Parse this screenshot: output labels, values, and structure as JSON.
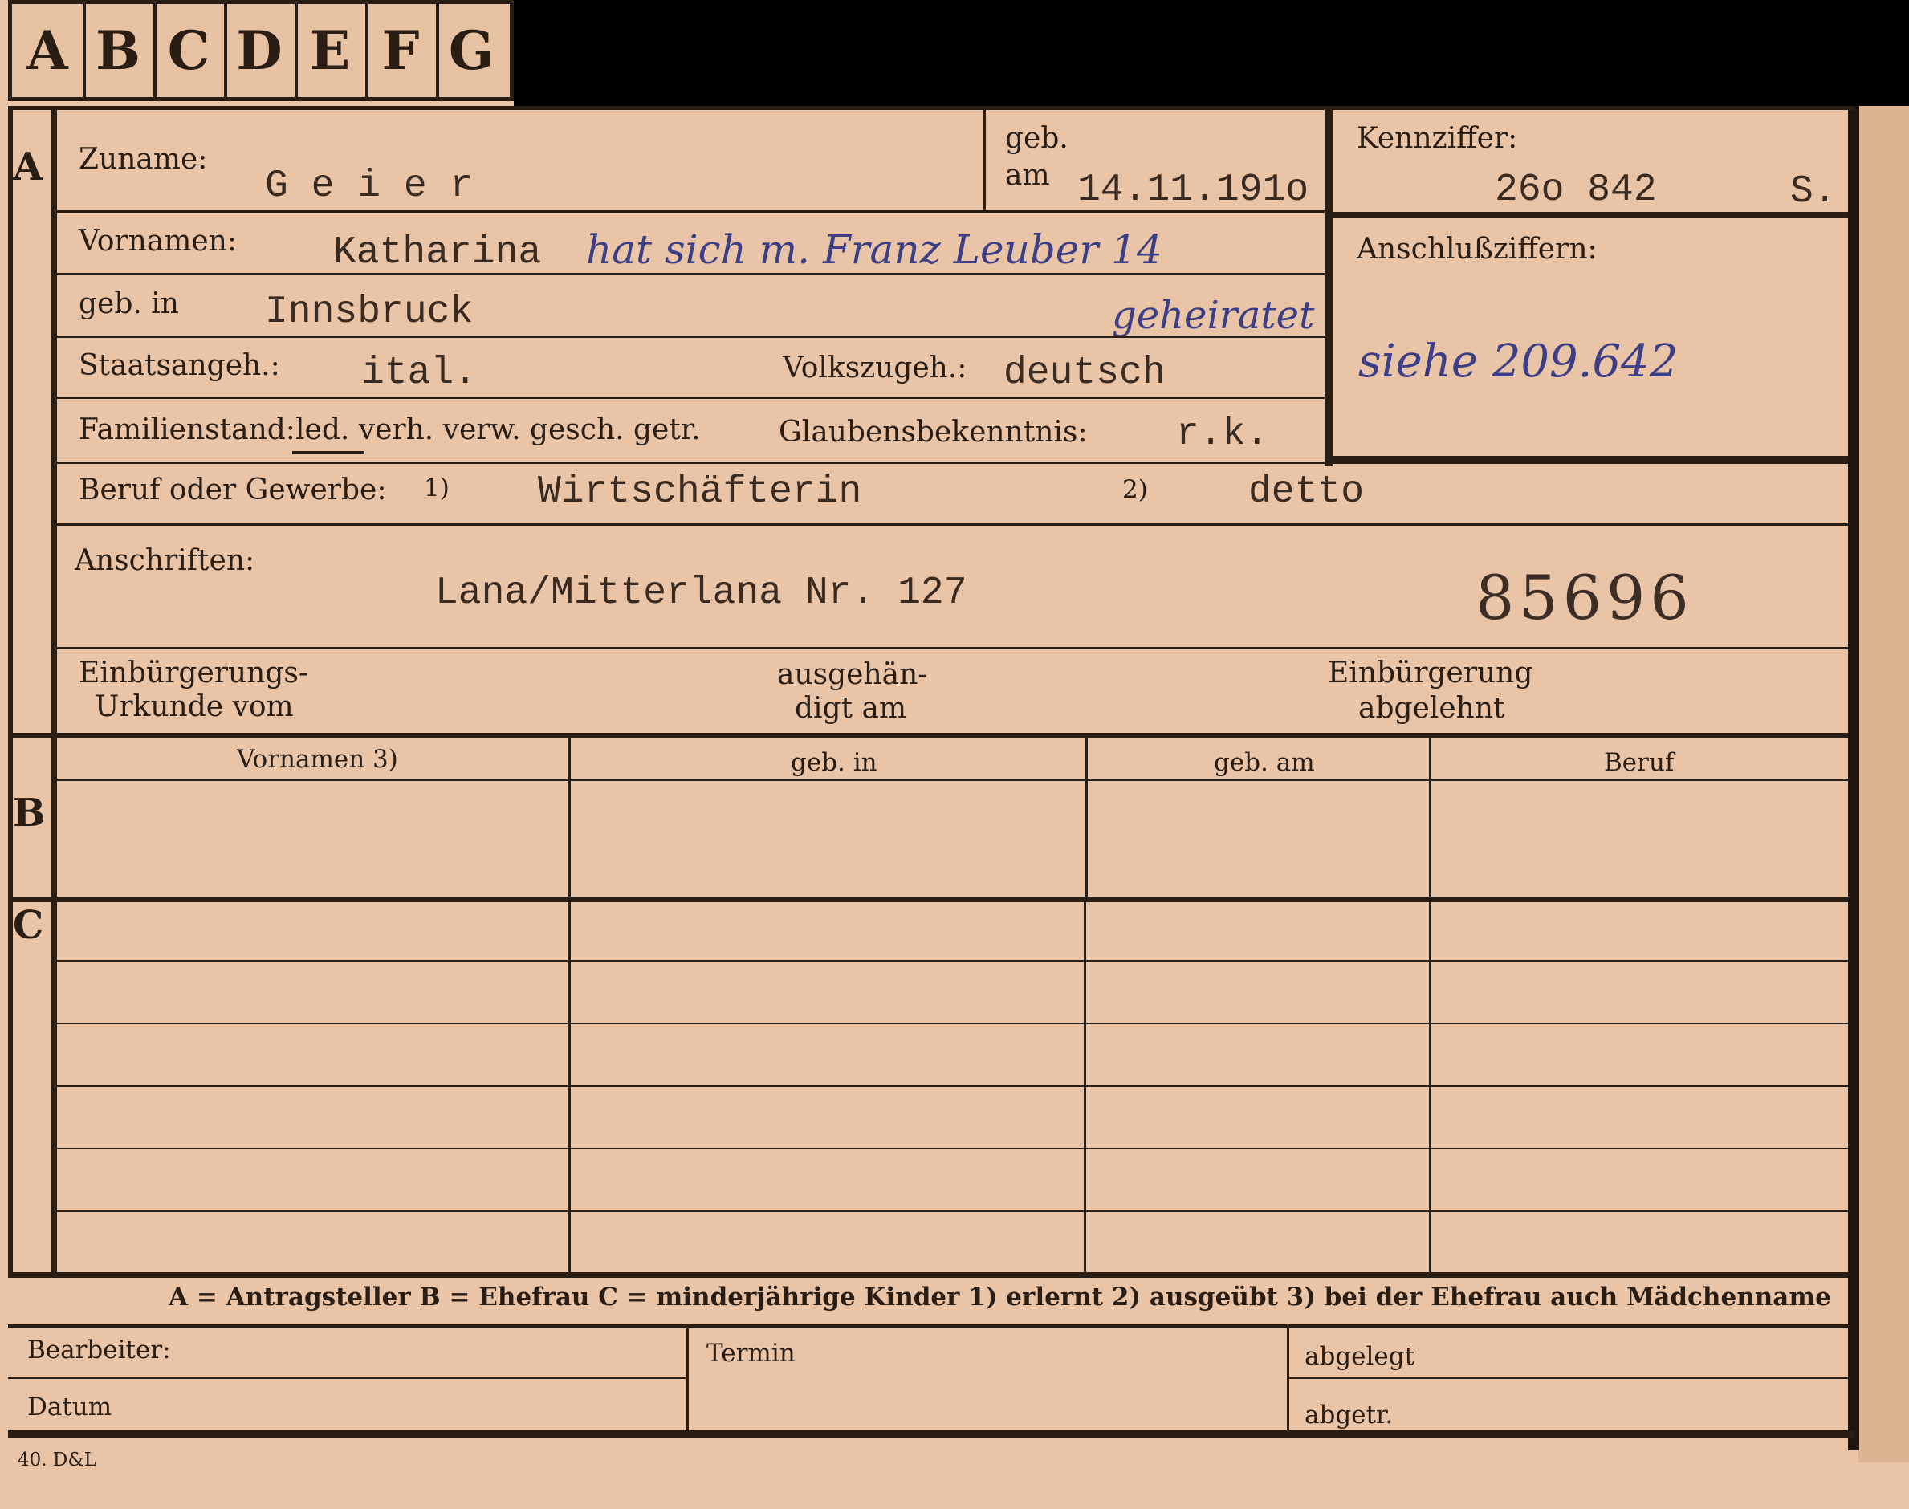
{
  "tabs": [
    "A",
    "B",
    "C",
    "D",
    "E",
    "F",
    "G"
  ],
  "sections": {
    "a": "A",
    "b": "B",
    "c": "C"
  },
  "person": {
    "zuname_label": "Zuname:",
    "zuname": "G e i e r",
    "geb_label": "geb.",
    "am_label": "am",
    "birth_date": "14.11.191o",
    "vornamen_label": "Vornamen:",
    "vornamen": "Katharina",
    "marriage_note": "hat sich m. Franz Leuber 14",
    "geb_in_label": "geb. in",
    "birthplace": "Innsbruck",
    "married_word": "geheiratet",
    "staatsangeh_label": "Staatsangeh.:",
    "staatsangeh": "ital.",
    "volkszugeh_label": "Volkszugeh.:",
    "volkszugeh": "deutsch",
    "familienstand_label": "Familienstand:",
    "familienstand_options": "led. verh. verw. gesch. getr.",
    "glaubens_label": "Glaubensbekenntnis:",
    "glaube": "r.k.",
    "beruf_label": "Beruf oder Gewerbe:",
    "beruf_mark1": "1)",
    "beruf1": "Wirtschäfterin",
    "beruf_mark2": "2)",
    "beruf2": "detto",
    "anschriften_label": "Anschriften:",
    "address": "Lana/Mitterlana Nr. 127",
    "stamp_number": "85696",
    "einb_urkunde_1": "Einbürgerungs-",
    "einb_urkunde_2": "Urkunde vom",
    "ausgehaendigt_1": "ausgehän-",
    "ausgehaendigt_2": "digt am",
    "einb_abgelehnt_1": "Einbürgerung",
    "einb_abgelehnt_2": "abgelehnt"
  },
  "right_box": {
    "kennziffer_label": "Kennziffer:",
    "kennziffer": "26o 842",
    "kennziffer_suffix": "S.",
    "anschluss_label": "Anschlußziffern:",
    "anschluss_note": "siehe 209.642"
  },
  "table": {
    "headers": [
      "Vornamen 3)",
      "geb. in",
      "geb. am",
      "Beruf"
    ]
  },
  "legend": "A = Antragsteller    B = Ehefrau    C = minderjährige Kinder    1) erlernt    2) ausgeübt    3) bei der Ehefrau auch Mädchenname",
  "footer": {
    "bearbeiter": "Bearbeiter:",
    "termin": "Termin",
    "abgelegt": "abgelegt",
    "datum": "Datum",
    "abgetr": "abgetr.",
    "print_mark": "40. D&L"
  }
}
